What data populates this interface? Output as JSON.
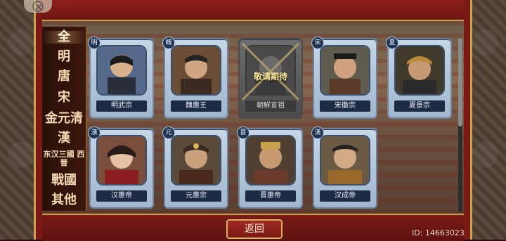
{
  "ui": {
    "categories": [
      {
        "label": "全",
        "active": true
      },
      {
        "label": "明"
      },
      {
        "label": "唐"
      },
      {
        "label": "宋"
      },
      {
        "label": "金元清"
      },
      {
        "label": "漢"
      },
      {
        "label": "东汉三國 西晉",
        "small": true
      },
      {
        "label": "戰國"
      },
      {
        "label": "其他"
      }
    ],
    "cards": [
      {
        "badge": "明",
        "name": "明武宗",
        "locked": false
      },
      {
        "badge": "魏",
        "name": "魏惠王",
        "locked": false
      },
      {
        "badge": "",
        "name": "朝鮮宣祖",
        "locked": true,
        "locked_text": "敬请期待"
      },
      {
        "badge": "宋",
        "name": "宋徽宗",
        "locked": false
      },
      {
        "badge": "夏",
        "name": "夏景宗",
        "locked": false
      },
      {
        "badge": "漢",
        "name": "汉惠帝",
        "locked": false
      },
      {
        "badge": "元",
        "name": "元惠宗",
        "locked": false
      },
      {
        "badge": "晋",
        "name": "晋惠帝",
        "locked": false
      },
      {
        "badge": "漢",
        "name": "汉成帝",
        "locked": false
      }
    ],
    "return_label": "返回",
    "id_label": "ID: 14663023"
  }
}
